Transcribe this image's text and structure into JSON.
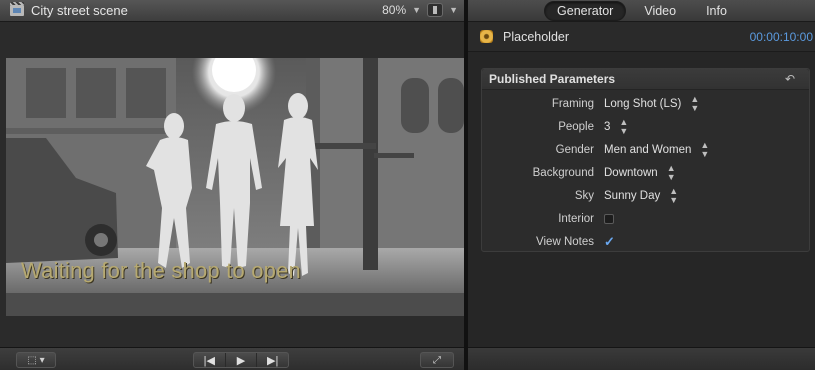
{
  "viewer": {
    "title": "City street scene",
    "zoom_value": "80%",
    "caption": "Waiting for the shop to open"
  },
  "inspector": {
    "tabs": [
      {
        "label": "Generator",
        "active": true
      },
      {
        "label": "Video",
        "active": false
      },
      {
        "label": "Info",
        "active": false
      }
    ],
    "item_name": "Placeholder",
    "timecode": "00:00:10:00",
    "published_parameters": {
      "title": "Published Parameters",
      "rows": [
        {
          "label": "Framing",
          "value": "Long Shot (LS)",
          "kind": "popup"
        },
        {
          "label": "People",
          "value": "3",
          "kind": "popup"
        },
        {
          "label": "Gender",
          "value": "Men and Women",
          "kind": "popup"
        },
        {
          "label": "Background",
          "value": "Downtown",
          "kind": "popup"
        },
        {
          "label": "Sky",
          "value": "Sunny Day",
          "kind": "popup"
        },
        {
          "label": "Interior",
          "checked": false,
          "kind": "checkbox"
        },
        {
          "label": "View Notes",
          "checked": true,
          "kind": "checkbox"
        }
      ]
    }
  },
  "colors": {
    "timecode": "#5b9ade",
    "caption": "#b6a971",
    "checkmark": "#6aa8f0"
  },
  "icons": {
    "stepper": "up-down-arrows",
    "reset": "reset-arrow",
    "transport": [
      "skip-back",
      "play",
      "skip-forward"
    ],
    "fullscreen": "expand-arrows",
    "view-options": "viewer-options"
  }
}
